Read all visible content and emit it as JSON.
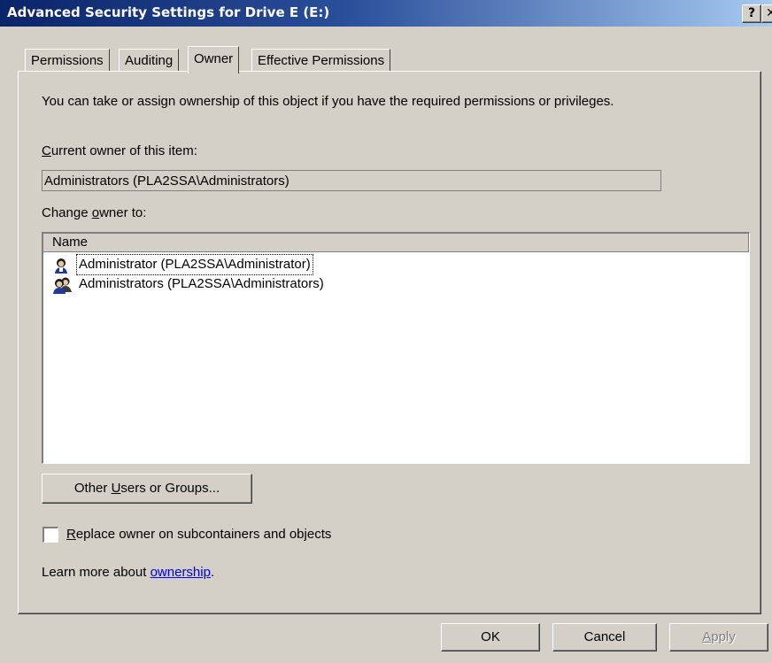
{
  "window": {
    "title": "Advanced Security Settings for Drive E (E:)",
    "help_button": "?",
    "close_button": "✕"
  },
  "tabs": [
    {
      "label": "Permissions",
      "active": false
    },
    {
      "label": "Auditing",
      "active": false
    },
    {
      "label": "Owner",
      "active": true
    },
    {
      "label": "Effective Permissions",
      "active": false
    }
  ],
  "owner": {
    "description": "You can take or assign ownership of this object if you have the required permissions or privileges.",
    "current_owner_label_mnemonic": "C",
    "current_owner_label_rest": "urrent owner of this item:",
    "current_owner_value": "Administrators (PLA2SSA\\Administrators)",
    "change_owner_label_pre": "Change ",
    "change_owner_label_mnemonic": "o",
    "change_owner_label_post": "wner to:",
    "list_header": "Name",
    "list_items": [
      {
        "label": "Administrator (PLA2SSA\\Administrator)",
        "icon": "user-icon"
      },
      {
        "label": "Administrators (PLA2SSA\\Administrators)",
        "icon": "group-icon"
      }
    ],
    "other_users_pre": "Other ",
    "other_users_mnemonic": "U",
    "other_users_post": "sers or Groups...",
    "replace_checkbox_mnemonic": "R",
    "replace_checkbox_rest": "eplace owner on subcontainers and objects",
    "replace_checked": false,
    "learn_more_prefix": "Learn more about ",
    "learn_more_link": "ownership",
    "learn_more_suffix": "."
  },
  "buttons": {
    "ok": "OK",
    "cancel": "Cancel",
    "apply_mnemonic": "A",
    "apply_rest": "pply"
  }
}
